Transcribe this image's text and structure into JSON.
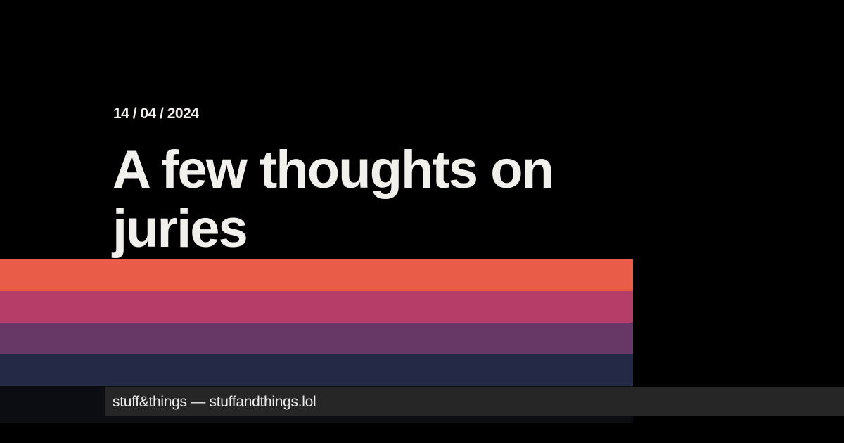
{
  "post": {
    "date": "14 / 04 / 2024",
    "title": "A few thoughts on juries"
  },
  "footer": {
    "site_label": "stuff&things — stuffandthings.lol"
  },
  "colors": {
    "background": "#000000",
    "text": "#f2f0ec",
    "stripe_1": "#e85c48",
    "stripe_2": "#b53d67",
    "stripe_3": "#673866",
    "stripe_4": "#242945",
    "footer_bar": "#262626"
  }
}
